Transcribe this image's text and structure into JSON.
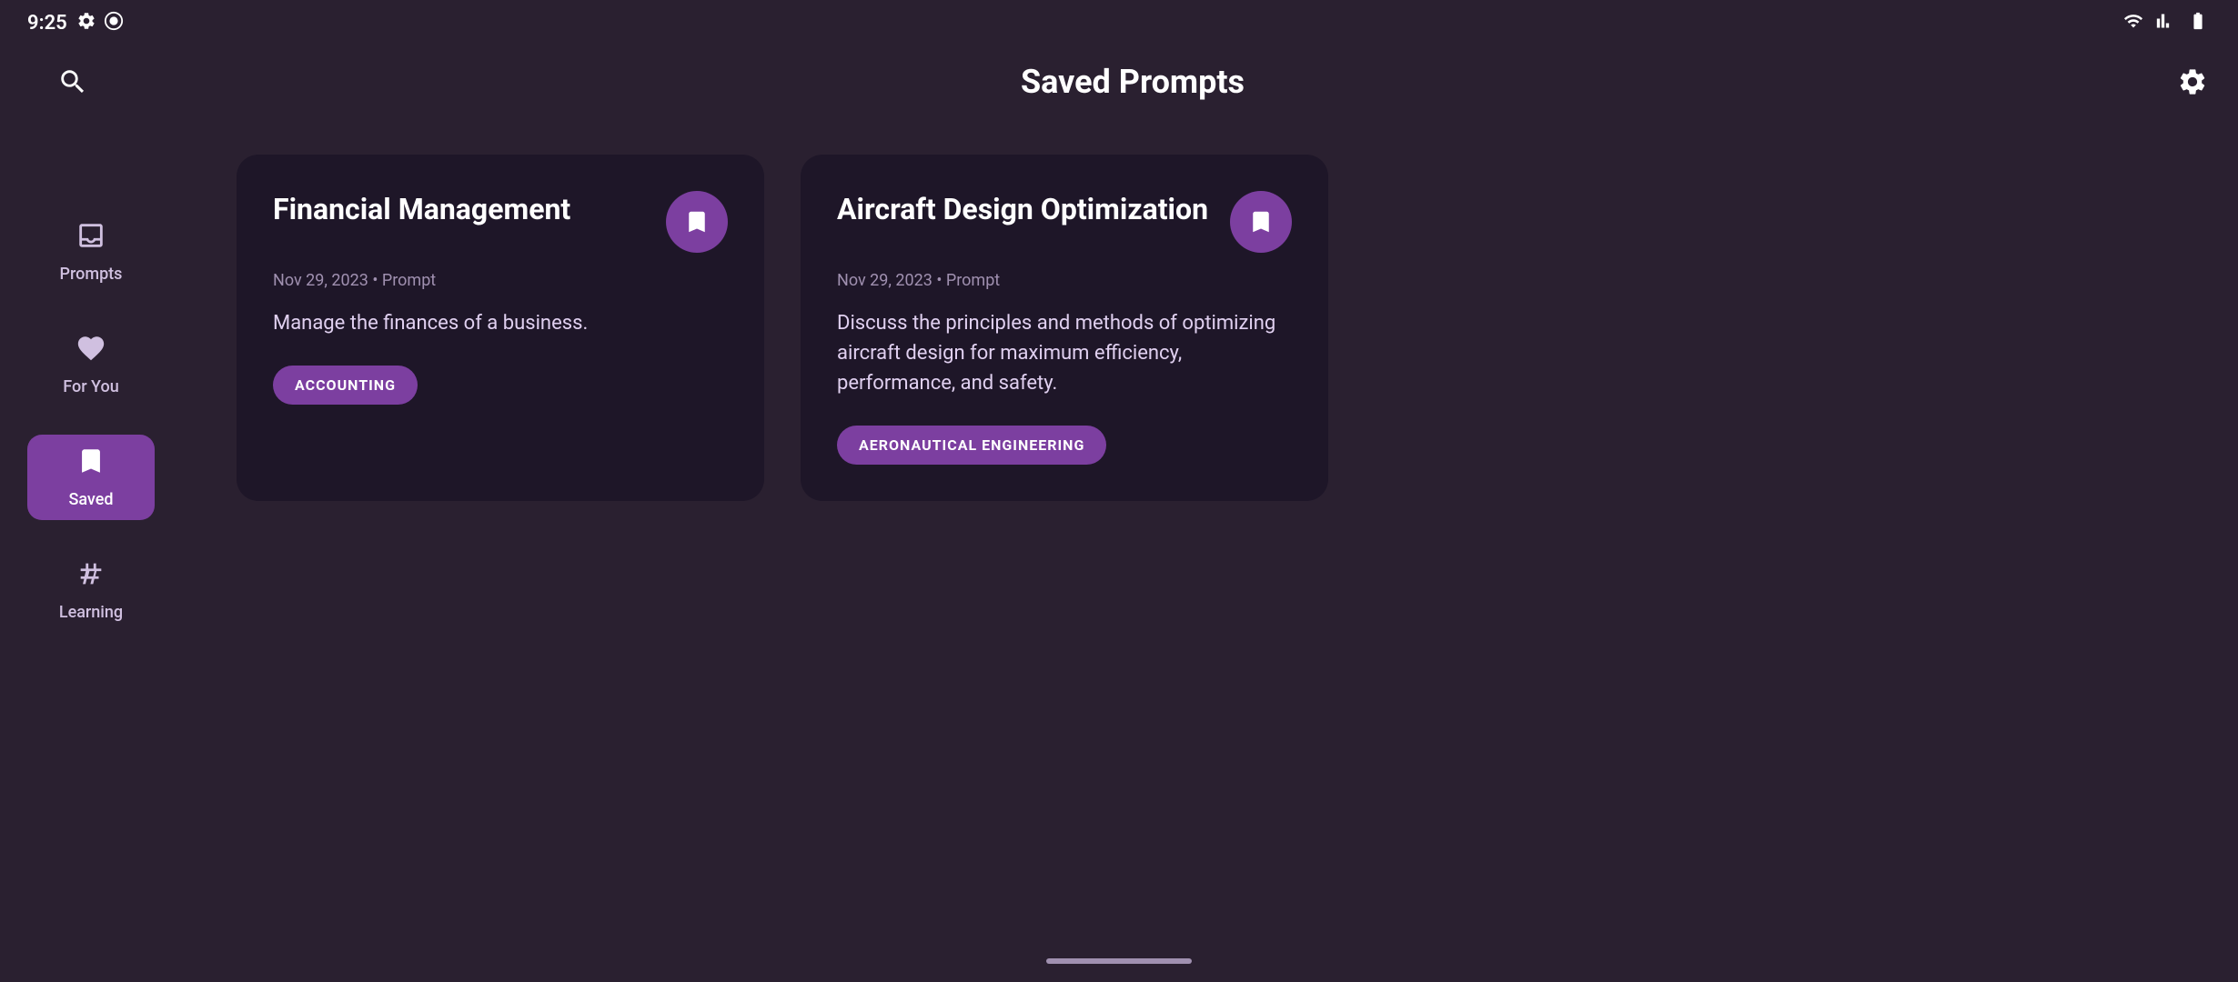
{
  "statusBar": {
    "time": "9:25",
    "icons": [
      "settings",
      "activity"
    ]
  },
  "header": {
    "title": "Saved Prompts",
    "searchLabel": "Search",
    "settingsLabel": "Settings"
  },
  "sidebar": {
    "items": [
      {
        "id": "prompts",
        "label": "Prompts",
        "icon": "inbox-icon",
        "active": false
      },
      {
        "id": "for-you",
        "label": "For You",
        "icon": "heart-icon",
        "active": false
      },
      {
        "id": "saved",
        "label": "Saved",
        "icon": "bookmark-icon",
        "active": true
      },
      {
        "id": "learning",
        "label": "Learning",
        "icon": "hashtag-icon",
        "active": false
      }
    ]
  },
  "cards": [
    {
      "id": "card1",
      "title": "Financial Management",
      "meta": "Nov 29, 2023 • Prompt",
      "description": "Manage the finances of a business.",
      "tag": "ACCOUNTING"
    },
    {
      "id": "card2",
      "title": "Aircraft Design Optimization",
      "meta": "Nov 29, 2023 • Prompt",
      "description": "Discuss the principles and methods of optimizing aircraft design for maximum efficiency, performance, and safety.",
      "tag": "AERONAUTICAL ENGINEERING"
    }
  ]
}
